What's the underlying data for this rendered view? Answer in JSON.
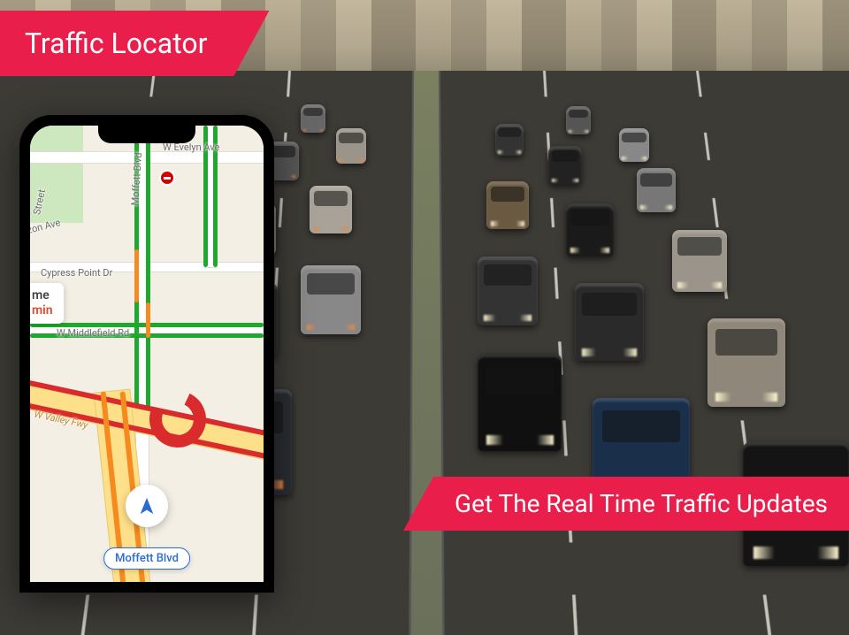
{
  "banners": {
    "top": "Traffic Locator",
    "bottom": "Get The Real Time Traffic Updates"
  },
  "phone_map": {
    "roads": [
      "W Evelyn Ave",
      "Horizon Ave",
      "Moffett Blvd",
      "Cypress Point Dr",
      "W Middlefield Rd",
      "W Valley Fwy"
    ],
    "time_card": {
      "title_suffix": "me",
      "value_suffix": "min"
    },
    "place_chip": "Moffett Blvd",
    "street_stub": "Street"
  },
  "colors": {
    "accent": "#EA1E4A",
    "traffic_green": "#1fa82e",
    "traffic_red": "#d92b2b",
    "traffic_orange": "#f58a1f",
    "time_value": "#e04a2f"
  }
}
